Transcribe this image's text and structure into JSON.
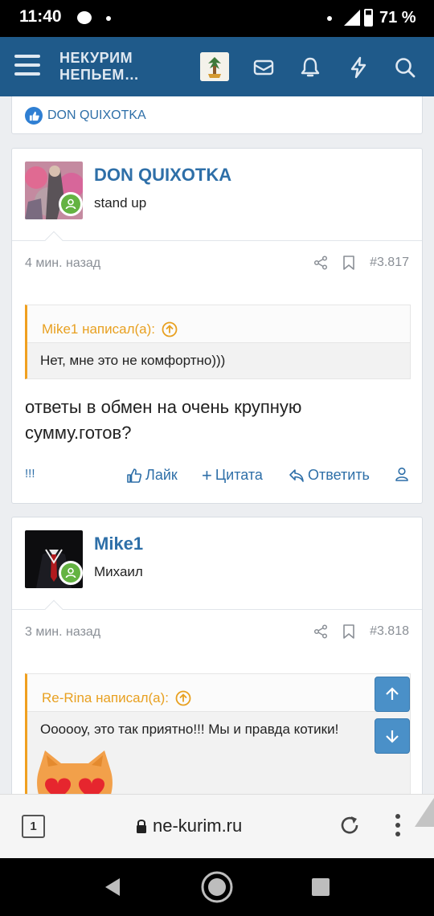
{
  "status": {
    "time": "11:40",
    "battery": "71 %"
  },
  "header": {
    "brand_line1": "НЕКУРИМ",
    "brand_line2": "НЕПЬЕМ…"
  },
  "top_card": {
    "reaction_user": "DON QUIXOTKA"
  },
  "posts": [
    {
      "username": "DON QUIXOTKA",
      "user_title": "stand up",
      "time": "4 мин. назад",
      "number": "#3.817",
      "quote_author": "Mike1 написал(а):",
      "quote_text": "Нет, мне это не комфортно)))",
      "text": "ответы в обмен на очень крупную сумму.готов?",
      "reactions": "!!!"
    },
    {
      "username": "Mike1",
      "user_title": "Михаил",
      "time": "3 мин. назад",
      "number": "#3.818",
      "quote_author": "Re-Rina написал(а):",
      "quote_text": "Оооооу, это так приятно!!! Мы и правда котики!"
    }
  ],
  "actions": {
    "like": "Лайк",
    "quote": "Цитата",
    "reply": "Ответить"
  },
  "browser": {
    "tabs": "1",
    "url": "ne-kurim.ru"
  },
  "colors": {
    "header": "#1f5a8a",
    "link": "#2e6fa8",
    "quote_accent": "#f0a020",
    "online": "#64b342"
  }
}
